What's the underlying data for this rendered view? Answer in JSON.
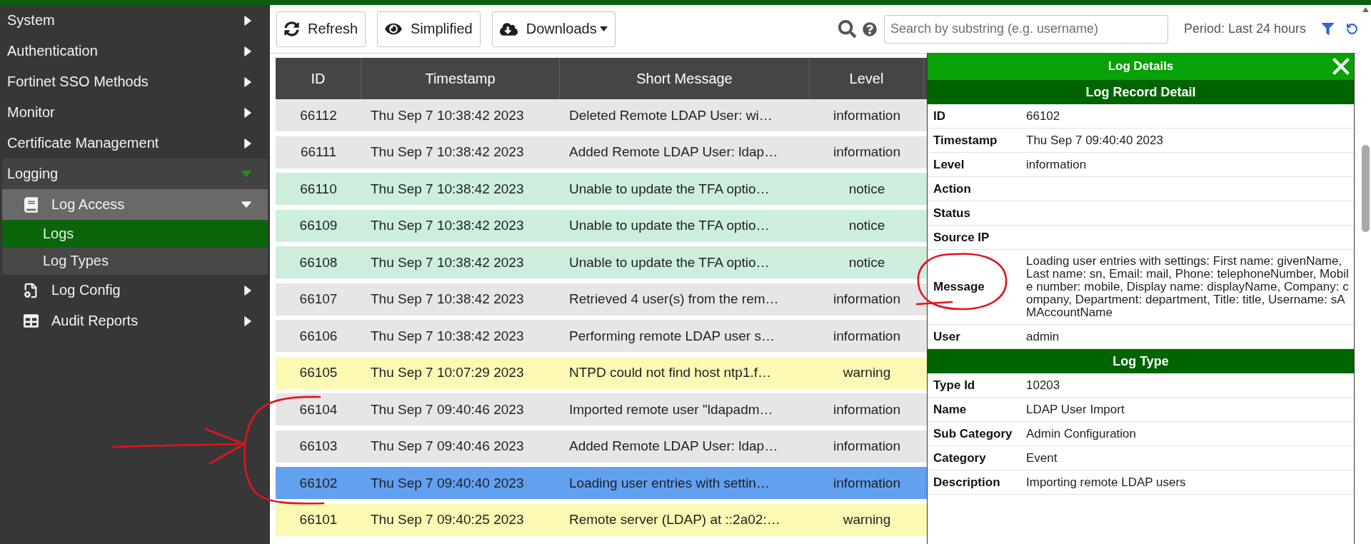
{
  "sidebar": {
    "items": [
      {
        "label": "System",
        "expanded": false
      },
      {
        "label": "Authentication",
        "expanded": false
      },
      {
        "label": "Fortinet SSO Methods",
        "expanded": false
      },
      {
        "label": "Monitor",
        "expanded": false
      },
      {
        "label": "Certificate Management",
        "expanded": false
      },
      {
        "label": "Logging",
        "expanded": true,
        "children": [
          {
            "label": "Log Access",
            "expanded": true,
            "children": [
              {
                "label": "Logs",
                "selected": true
              },
              {
                "label": "Log Types",
                "selected": false
              }
            ]
          },
          {
            "label": "Log Config",
            "expanded": false
          },
          {
            "label": "Audit Reports",
            "expanded": false
          }
        ]
      }
    ]
  },
  "toolbar": {
    "buttons": [
      {
        "label": "Refresh",
        "dropdown": false
      },
      {
        "label": "Simplified",
        "dropdown": false
      },
      {
        "label": "Downloads",
        "dropdown": true
      }
    ],
    "search": {
      "placeholder": "Search by substring (e.g. username)"
    },
    "period": "Period: Last 24 hours"
  },
  "table": {
    "columns": [
      "ID",
      "Timestamp",
      "Short Message",
      "Level"
    ],
    "rows": [
      {
        "cells": [
          "66112",
          "Thu Sep 7 10:38:42 2023",
          "Deleted Remote LDAP User: wi…",
          "information"
        ],
        "color": "#e6e6e6",
        "selected": false
      },
      {
        "cells": [
          "66111",
          "Thu Sep 7 10:38:42 2023",
          "Added Remote LDAP User: ldap…",
          "information"
        ],
        "color": "#e6e6e6",
        "selected": false
      },
      {
        "cells": [
          "66110",
          "Thu Sep 7 10:38:42 2023",
          "Unable to update the TFA optio…",
          "notice"
        ],
        "color": "#cdeedc",
        "selected": false
      },
      {
        "cells": [
          "66109",
          "Thu Sep 7 10:38:42 2023",
          "Unable to update the TFA optio…",
          "notice"
        ],
        "color": "#cdeedc",
        "selected": false
      },
      {
        "cells": [
          "66108",
          "Thu Sep 7 10:38:42 2023",
          "Unable to update the TFA optio…",
          "notice"
        ],
        "color": "#cdeedc",
        "selected": false
      },
      {
        "cells": [
          "66107",
          "Thu Sep 7 10:38:42 2023",
          "Retrieved 4 user(s) from the rem…",
          "information"
        ],
        "color": "#e6e6e6",
        "selected": false
      },
      {
        "cells": [
          "66106",
          "Thu Sep 7 10:38:42 2023",
          "Performing remote LDAP user s…",
          "information"
        ],
        "color": "#e6e6e6",
        "selected": false
      },
      {
        "cells": [
          "66105",
          "Thu Sep 7 10:07:29 2023",
          "NTPD could not find host ntp1.f…",
          "warning"
        ],
        "color": "#fbf9b4",
        "selected": false
      },
      {
        "cells": [
          "66104",
          "Thu Sep 7 09:40:46 2023",
          "Imported remote user \"ldapadm…",
          "information"
        ],
        "color": "#e6e6e6",
        "selected": false
      },
      {
        "cells": [
          "66103",
          "Thu Sep 7 09:40:46 2023",
          "Added Remote LDAP User: ldap…",
          "information"
        ],
        "color": "#e6e6e6",
        "selected": false
      },
      {
        "cells": [
          "66102",
          "Thu Sep 7 09:40:40 2023",
          "Loading user entries with settin…",
          "information"
        ],
        "selected": true
      },
      {
        "cells": [
          "66101",
          "Thu Sep 7 09:40:25 2023",
          "Remote server (LDAP) at ::2a02:…",
          "warning"
        ],
        "color": "#fbf9b4",
        "selected": false
      }
    ]
  },
  "log_details": {
    "title": "Log Details",
    "sections": [
      {
        "title": "Log Record Detail",
        "fields": [
          {
            "label": "ID",
            "value": "66102"
          },
          {
            "label": "Timestamp",
            "value": "Thu Sep 7 09:40:40 2023"
          },
          {
            "label": "Level",
            "value": "information"
          },
          {
            "label": "Action"
          },
          {
            "label": "Status"
          },
          {
            "label": "Source IP"
          },
          {
            "label": "Message",
            "value": "Loading user entries with settings: First name: givenName, Last name: sn, Email: mail, Phone: telephoneNumber, Mobile number: mobile, Display name: displayName, Company: company, Department: department, Title: title, Username: sAMAccountName"
          },
          {
            "label": "User",
            "value": "admin"
          }
        ]
      },
      {
        "title": "Log Type",
        "fields": [
          {
            "label": "Type Id",
            "value": "10203"
          },
          {
            "label": "Name",
            "value": "LDAP User Import"
          },
          {
            "label": "Sub Category",
            "value": "Admin Configuration"
          },
          {
            "label": "Category",
            "value": "Event"
          },
          {
            "label": "Description",
            "value": "Importing remote LDAP users"
          }
        ]
      }
    ]
  },
  "annotations": [
    {
      "kind": "arrow"
    },
    {
      "kind": "bracket"
    },
    {
      "kind": "circle"
    }
  ]
}
